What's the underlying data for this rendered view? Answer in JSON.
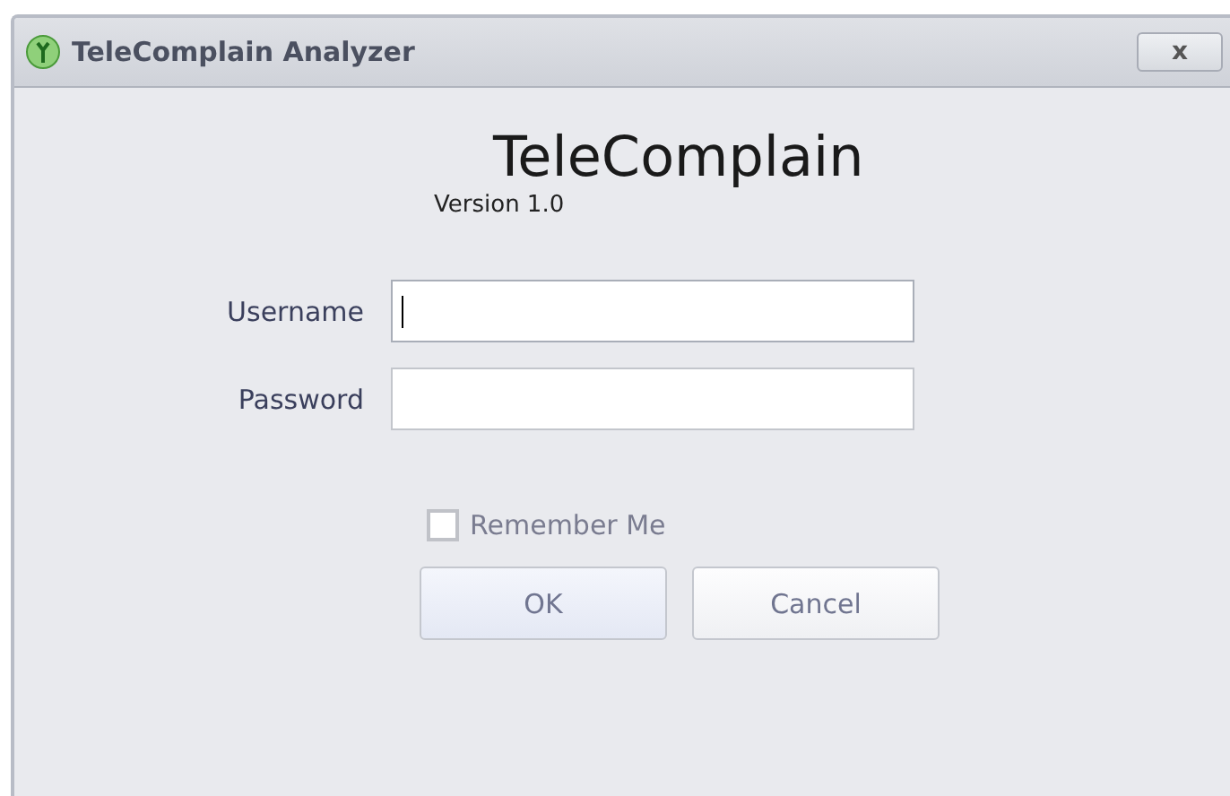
{
  "window": {
    "title": "TeleComplain Analyzer",
    "close": "x"
  },
  "app_name": "TeleComplain",
  "version": "Version 1.0",
  "fields": [
    {
      "label": "Username",
      "focused": true
    },
    {
      "label": "Password",
      "focused": false
    }
  ],
  "remember_me": {
    "label": "Remember Me",
    "checked": false
  },
  "buttons": [
    "OK",
    "Cancel"
  ]
}
